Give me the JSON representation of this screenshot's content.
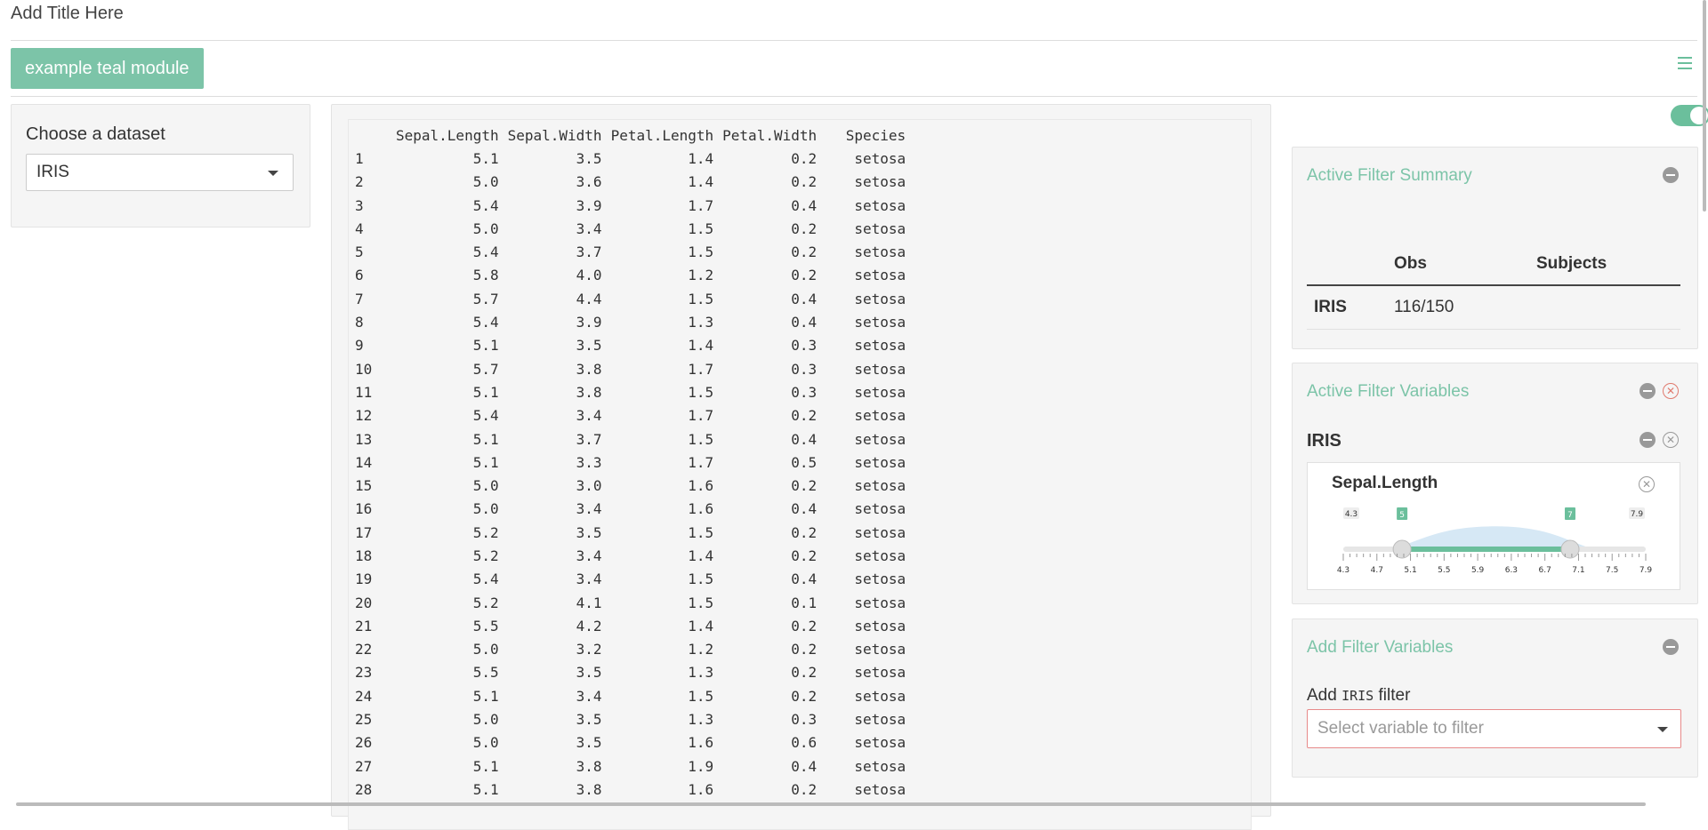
{
  "app": {
    "title": "Add Title Here"
  },
  "module_tab": {
    "label": "example teal module"
  },
  "encoding": {
    "label": "Choose a dataset",
    "selected": "IRIS"
  },
  "data_table": {
    "headers": [
      "",
      "Sepal.Length",
      "Sepal.Width",
      "Petal.Length",
      "Petal.Width",
      "Species"
    ],
    "rows": [
      [
        "1",
        "5.1",
        "3.5",
        "1.4",
        "0.2",
        "setosa"
      ],
      [
        "2",
        "5.0",
        "3.6",
        "1.4",
        "0.2",
        "setosa"
      ],
      [
        "3",
        "5.4",
        "3.9",
        "1.7",
        "0.4",
        "setosa"
      ],
      [
        "4",
        "5.0",
        "3.4",
        "1.5",
        "0.2",
        "setosa"
      ],
      [
        "5",
        "5.4",
        "3.7",
        "1.5",
        "0.2",
        "setosa"
      ],
      [
        "6",
        "5.8",
        "4.0",
        "1.2",
        "0.2",
        "setosa"
      ],
      [
        "7",
        "5.7",
        "4.4",
        "1.5",
        "0.4",
        "setosa"
      ],
      [
        "8",
        "5.4",
        "3.9",
        "1.3",
        "0.4",
        "setosa"
      ],
      [
        "9",
        "5.1",
        "3.5",
        "1.4",
        "0.3",
        "setosa"
      ],
      [
        "10",
        "5.7",
        "3.8",
        "1.7",
        "0.3",
        "setosa"
      ],
      [
        "11",
        "5.1",
        "3.8",
        "1.5",
        "0.3",
        "setosa"
      ],
      [
        "12",
        "5.4",
        "3.4",
        "1.7",
        "0.2",
        "setosa"
      ],
      [
        "13",
        "5.1",
        "3.7",
        "1.5",
        "0.4",
        "setosa"
      ],
      [
        "14",
        "5.1",
        "3.3",
        "1.7",
        "0.5",
        "setosa"
      ],
      [
        "15",
        "5.0",
        "3.0",
        "1.6",
        "0.2",
        "setosa"
      ],
      [
        "16",
        "5.0",
        "3.4",
        "1.6",
        "0.4",
        "setosa"
      ],
      [
        "17",
        "5.2",
        "3.5",
        "1.5",
        "0.2",
        "setosa"
      ],
      [
        "18",
        "5.2",
        "3.4",
        "1.4",
        "0.2",
        "setosa"
      ],
      [
        "19",
        "5.4",
        "3.4",
        "1.5",
        "0.4",
        "setosa"
      ],
      [
        "20",
        "5.2",
        "4.1",
        "1.5",
        "0.1",
        "setosa"
      ],
      [
        "21",
        "5.5",
        "4.2",
        "1.4",
        "0.2",
        "setosa"
      ],
      [
        "22",
        "5.0",
        "3.2",
        "1.2",
        "0.2",
        "setosa"
      ],
      [
        "23",
        "5.5",
        "3.5",
        "1.3",
        "0.2",
        "setosa"
      ],
      [
        "24",
        "5.1",
        "3.4",
        "1.5",
        "0.2",
        "setosa"
      ],
      [
        "25",
        "5.0",
        "3.5",
        "1.3",
        "0.3",
        "setosa"
      ],
      [
        "26",
        "5.0",
        "3.5",
        "1.6",
        "0.6",
        "setosa"
      ],
      [
        "27",
        "5.1",
        "3.8",
        "1.9",
        "0.4",
        "setosa"
      ],
      [
        "28",
        "5.1",
        "3.8",
        "1.6",
        "0.2",
        "setosa"
      ]
    ]
  },
  "filter_summary": {
    "title": "Active Filter Summary",
    "columns": [
      "",
      "Obs",
      "Subjects"
    ],
    "rows": [
      {
        "dataset": "IRIS",
        "obs": "116/150",
        "subjects": ""
      }
    ]
  },
  "active_vars": {
    "title": "Active Filter Variables",
    "dataset": "IRIS",
    "filter": {
      "name": "Sepal.Length",
      "min_label": "4.3",
      "max_label": "7.9",
      "from_label": "5",
      "to_label": "7",
      "min": 4.3,
      "max": 7.9,
      "from": 5,
      "to": 7,
      "ticks": [
        "4.3",
        "4.7",
        "5.1",
        "5.5",
        "5.9",
        "6.3",
        "6.7",
        "7.1",
        "7.5",
        "7.9"
      ]
    }
  },
  "add_filter": {
    "title": "Add Filter Variables",
    "label_prefix": "Add",
    "label_code": "IRIS",
    "label_suffix": "filter",
    "placeholder": "Select variable to filter"
  },
  "colors": {
    "accent": "#7cc4a8",
    "toggle": "#6bbf9c",
    "danger": "#e07a6e"
  }
}
